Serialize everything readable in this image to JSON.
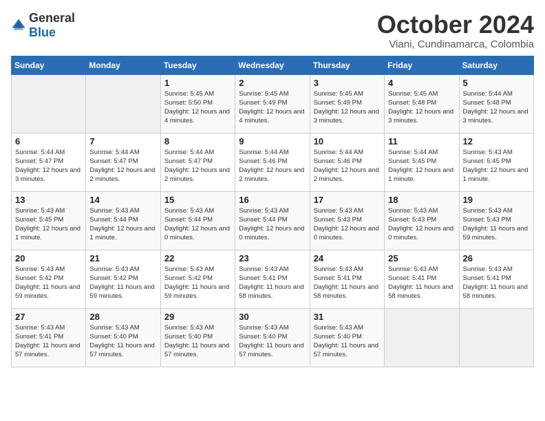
{
  "logo": {
    "general": "General",
    "blue": "Blue"
  },
  "calendar": {
    "title": "October 2024",
    "subtitle": "Viani, Cundinamarca, Colombia"
  },
  "days_of_week": [
    "Sunday",
    "Monday",
    "Tuesday",
    "Wednesday",
    "Thursday",
    "Friday",
    "Saturday"
  ],
  "weeks": [
    [
      {
        "day": "",
        "info": ""
      },
      {
        "day": "",
        "info": ""
      },
      {
        "day": "1",
        "info": "Sunrise: 5:45 AM\nSunset: 5:50 PM\nDaylight: 12 hours and 4 minutes."
      },
      {
        "day": "2",
        "info": "Sunrise: 5:45 AM\nSunset: 5:49 PM\nDaylight: 12 hours and 4 minutes."
      },
      {
        "day": "3",
        "info": "Sunrise: 5:45 AM\nSunset: 5:49 PM\nDaylight: 12 hours and 3 minutes."
      },
      {
        "day": "4",
        "info": "Sunrise: 5:45 AM\nSunset: 5:48 PM\nDaylight: 12 hours and 3 minutes."
      },
      {
        "day": "5",
        "info": "Sunrise: 5:44 AM\nSunset: 5:48 PM\nDaylight: 12 hours and 3 minutes."
      }
    ],
    [
      {
        "day": "6",
        "info": "Sunrise: 5:44 AM\nSunset: 5:47 PM\nDaylight: 12 hours and 3 minutes."
      },
      {
        "day": "7",
        "info": "Sunrise: 5:44 AM\nSunset: 5:47 PM\nDaylight: 12 hours and 2 minutes."
      },
      {
        "day": "8",
        "info": "Sunrise: 5:44 AM\nSunset: 5:47 PM\nDaylight: 12 hours and 2 minutes."
      },
      {
        "day": "9",
        "info": "Sunrise: 5:44 AM\nSunset: 5:46 PM\nDaylight: 12 hours and 2 minutes."
      },
      {
        "day": "10",
        "info": "Sunrise: 5:44 AM\nSunset: 5:46 PM\nDaylight: 12 hours and 2 minutes."
      },
      {
        "day": "11",
        "info": "Sunrise: 5:44 AM\nSunset: 5:45 PM\nDaylight: 12 hours and 1 minute."
      },
      {
        "day": "12",
        "info": "Sunrise: 5:43 AM\nSunset: 5:45 PM\nDaylight: 12 hours and 1 minute."
      }
    ],
    [
      {
        "day": "13",
        "info": "Sunrise: 5:43 AM\nSunset: 5:45 PM\nDaylight: 12 hours and 1 minute."
      },
      {
        "day": "14",
        "info": "Sunrise: 5:43 AM\nSunset: 5:44 PM\nDaylight: 12 hours and 1 minute."
      },
      {
        "day": "15",
        "info": "Sunrise: 5:43 AM\nSunset: 5:44 PM\nDaylight: 12 hours and 0 minutes."
      },
      {
        "day": "16",
        "info": "Sunrise: 5:43 AM\nSunset: 5:44 PM\nDaylight: 12 hours and 0 minutes."
      },
      {
        "day": "17",
        "info": "Sunrise: 5:43 AM\nSunset: 5:43 PM\nDaylight: 12 hours and 0 minutes."
      },
      {
        "day": "18",
        "info": "Sunrise: 5:43 AM\nSunset: 5:43 PM\nDaylight: 12 hours and 0 minutes."
      },
      {
        "day": "19",
        "info": "Sunrise: 5:43 AM\nSunset: 5:43 PM\nDaylight: 11 hours and 59 minutes."
      }
    ],
    [
      {
        "day": "20",
        "info": "Sunrise: 5:43 AM\nSunset: 5:42 PM\nDaylight: 11 hours and 59 minutes."
      },
      {
        "day": "21",
        "info": "Sunrise: 5:43 AM\nSunset: 5:42 PM\nDaylight: 11 hours and 59 minutes."
      },
      {
        "day": "22",
        "info": "Sunrise: 5:43 AM\nSunset: 5:42 PM\nDaylight: 11 hours and 59 minutes."
      },
      {
        "day": "23",
        "info": "Sunrise: 5:43 AM\nSunset: 5:41 PM\nDaylight: 11 hours and 58 minutes."
      },
      {
        "day": "24",
        "info": "Sunrise: 5:43 AM\nSunset: 5:41 PM\nDaylight: 11 hours and 58 minutes."
      },
      {
        "day": "25",
        "info": "Sunrise: 5:43 AM\nSunset: 5:41 PM\nDaylight: 11 hours and 58 minutes."
      },
      {
        "day": "26",
        "info": "Sunrise: 5:43 AM\nSunset: 5:41 PM\nDaylight: 11 hours and 58 minutes."
      }
    ],
    [
      {
        "day": "27",
        "info": "Sunrise: 5:43 AM\nSunset: 5:41 PM\nDaylight: 11 hours and 57 minutes."
      },
      {
        "day": "28",
        "info": "Sunrise: 5:43 AM\nSunset: 5:40 PM\nDaylight: 11 hours and 57 minutes."
      },
      {
        "day": "29",
        "info": "Sunrise: 5:43 AM\nSunset: 5:40 PM\nDaylight: 11 hours and 57 minutes."
      },
      {
        "day": "30",
        "info": "Sunrise: 5:43 AM\nSunset: 5:40 PM\nDaylight: 11 hours and 57 minutes."
      },
      {
        "day": "31",
        "info": "Sunrise: 5:43 AM\nSunset: 5:40 PM\nDaylight: 11 hours and 57 minutes."
      },
      {
        "day": "",
        "info": ""
      },
      {
        "day": "",
        "info": ""
      }
    ]
  ]
}
